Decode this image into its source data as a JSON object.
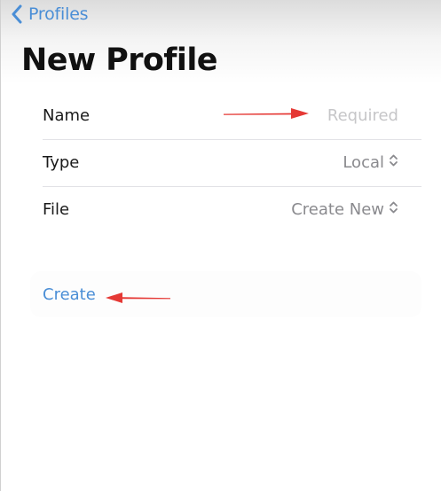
{
  "nav": {
    "back_label": "Profiles"
  },
  "page": {
    "title": "New Profile"
  },
  "form": {
    "name": {
      "label": "Name",
      "value": "",
      "placeholder": "Required"
    },
    "type": {
      "label": "Type",
      "value": "Local"
    },
    "file": {
      "label": "File",
      "value": "Create New"
    }
  },
  "actions": {
    "create_label": "Create"
  },
  "colors": {
    "accent": "#4a8ed6",
    "annotation": "#e53935"
  },
  "icons": {
    "back": "chevron-left-icon",
    "picker": "chevron-up-down-icon",
    "annotation": "arrow-icon"
  }
}
